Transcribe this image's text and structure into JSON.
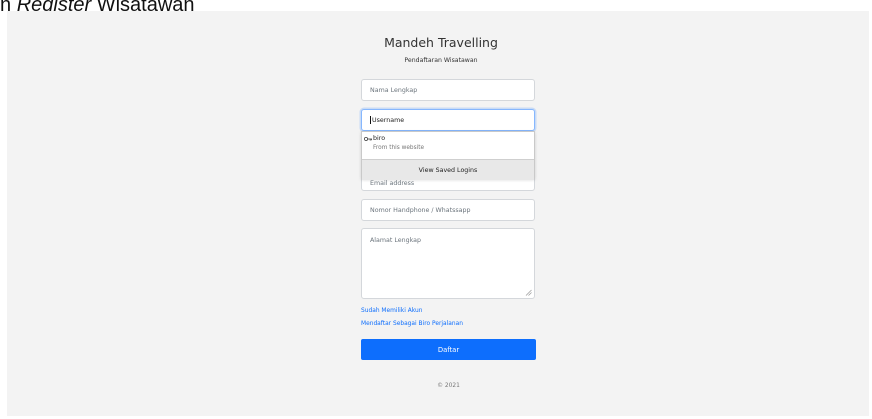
{
  "caption": {
    "prefix": "n ",
    "italic": "Register",
    "suffix": " Wisatawan"
  },
  "header": {
    "title": "Mandeh Travelling",
    "subtitle": "Pendaftaran Wisatawan"
  },
  "form": {
    "full_name_placeholder": "Nama Lengkap",
    "username_placeholder": "Username",
    "email_placeholder": "Email address",
    "phone_placeholder": "Nomor Handphone / Whatssapp",
    "address_placeholder": "Alamat Lengkap"
  },
  "autofill": {
    "username": "biro",
    "source": "From this website",
    "action": "View Saved Logins"
  },
  "links": {
    "have_account": "Sudah Memiliki Akun",
    "register_agency": "Mendaftar Sebagai Biro Perjalanan"
  },
  "actions": {
    "submit": "Daftar"
  },
  "footer": {
    "copyright": "© 2021"
  },
  "colors": {
    "primary": "#0d6efd",
    "background": "#f3f3f3"
  }
}
